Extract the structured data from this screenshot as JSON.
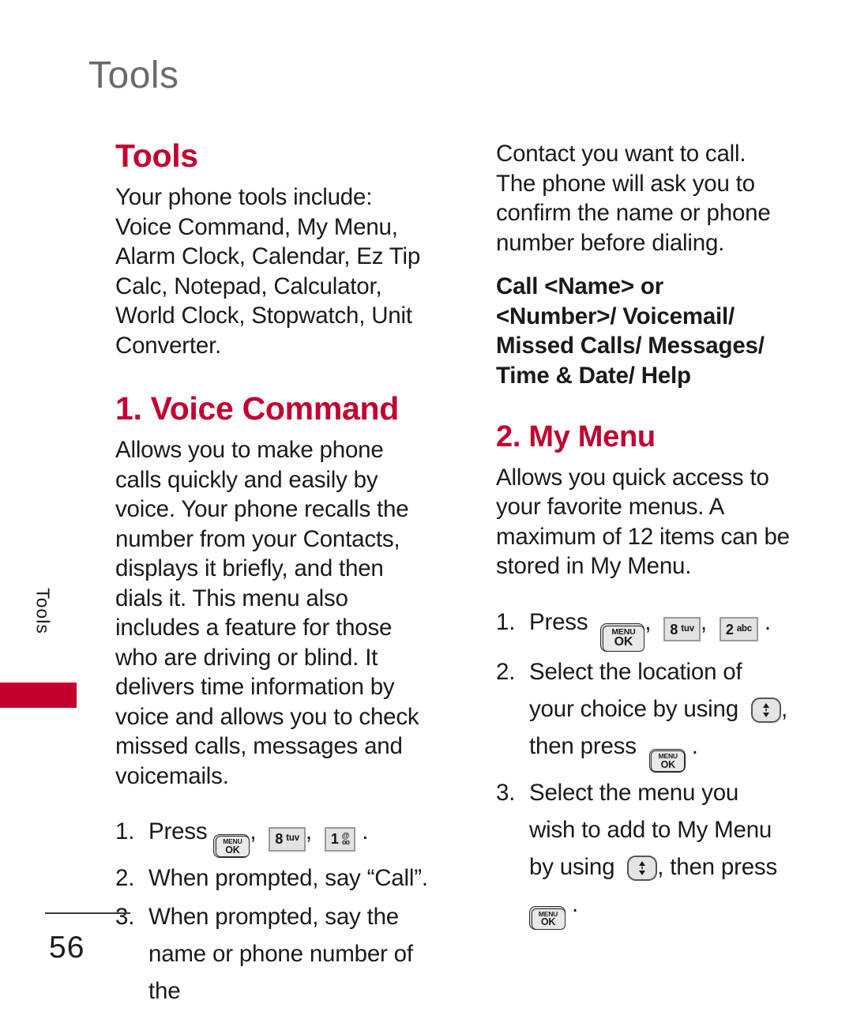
{
  "page": {
    "running_head": "Tools",
    "side_tab_label": "Tools",
    "page_number": "56",
    "accent_color": "#c20030",
    "running_head_color": "#6b6b6b"
  },
  "left_column": {
    "title": "Tools",
    "intro": "Your phone tools include: Voice Command, My Menu, Alarm Clock, Calendar, Ez Tip Calc, Notepad, Calculator, World Clock, Stopwatch, Unit Converter.",
    "section": {
      "title": "1. Voice Command",
      "body": "Allows you to make phone calls quickly and easily by voice. Your phone recalls the number from your Contacts, displays it briefly, and then dials it. This menu also includes a feature for those who are driving or blind. It delivers time information by voice and allows you to check missed calls, messages and voicemails.",
      "steps": [
        {
          "num": "1.",
          "text_before": "Press",
          "keys": [
            "menu-ok",
            "8-tuv",
            "1-voicemail"
          ],
          "separators": [
            ",",
            ",",
            "."
          ]
        },
        {
          "num": "2.",
          "text": "When prompted, say “Call”."
        },
        {
          "num": "3.",
          "text": "When prompted, say the name or phone number of the"
        }
      ]
    }
  },
  "right_column": {
    "continuation": "Contact you want to call. The phone will ask you to confirm the name or phone number before dialing.",
    "command_list": "Call <Name> or <Number>/ Voicemail/ Missed Calls/ Messages/ Time & Date/ Help",
    "section": {
      "title": "2. My Menu",
      "body": "Allows you quick access to your favorite menus. A maximum of 12 items can be stored in My Menu.",
      "steps": [
        {
          "num": "1.",
          "text_before": "Press",
          "keys": [
            "menu-ok",
            "8-tuv",
            "2-abc"
          ]
        },
        {
          "num": "2.",
          "text_before": "Select the location of your choice by using",
          "text_middle": ", then press",
          "text_after": "."
        },
        {
          "num": "3.",
          "text_before": "Select the menu you wish to add to My Menu by using",
          "text_middle": ", then press",
          "text_after": "."
        }
      ]
    }
  },
  "keys": {
    "menu_ok": {
      "top": "MENU",
      "bottom": "OK"
    },
    "key_8": {
      "digit": "8",
      "letters": "tuv"
    },
    "key_2": {
      "digit": "2",
      "letters": "abc"
    },
    "key_1": {
      "digit": "1",
      "symbol": "@",
      "reels": "oo"
    },
    "nav": {
      "up": "▲",
      "down": "▼"
    }
  },
  "punctuation": {
    "comma": ",",
    "period": "."
  }
}
